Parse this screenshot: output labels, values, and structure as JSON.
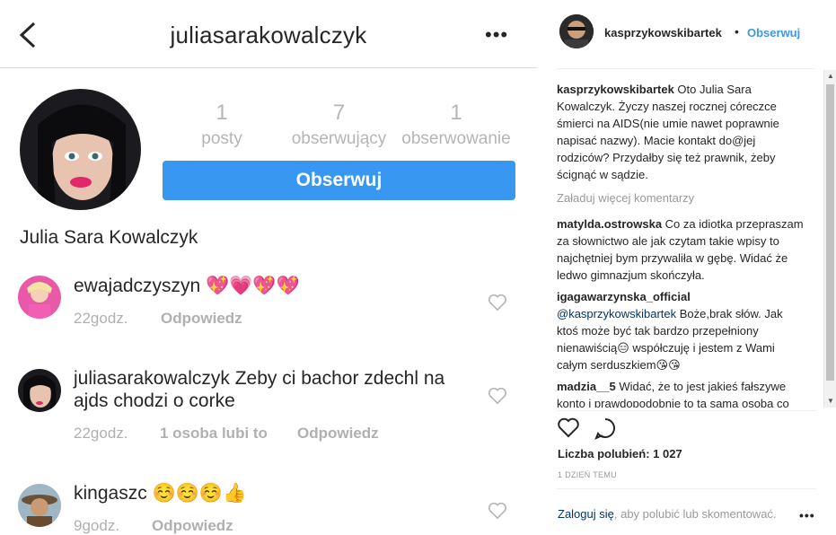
{
  "phone": {
    "header": {
      "username": "juliasarakowalczyk",
      "more_icon": "more-horizontal-icon",
      "back_icon": "chevron-left-icon"
    },
    "profile": {
      "stats": [
        {
          "value": "1",
          "label": "posty"
        },
        {
          "value": "7",
          "label": "obserwujący"
        },
        {
          "value": "1",
          "label": "obserwowanie"
        }
      ],
      "follow_label": "Obserwuj",
      "full_name": "Julia Sara Kowalczyk"
    },
    "comments": [
      {
        "text": "ewajadczyszyn 💖💗💖💖",
        "time": "22godz.",
        "likes": "",
        "reply": "Odpowiedz"
      },
      {
        "text": "juliasarakowalczyk Zeby ci bachor zdechl na ajds chodzi o corke",
        "time": "22godz.",
        "likes": "1 osoba lubi to",
        "reply": "Odpowiedz"
      },
      {
        "text": "kingaszc ☺️☺️☺️👍",
        "time": "9godz.",
        "likes": "",
        "reply": "Odpowiedz"
      }
    ]
  },
  "panel": {
    "username": "kasprzykowskibartek",
    "dot": "•",
    "follow_label": "Obserwuj",
    "caption": {
      "user": "kasprzykowskibartek",
      "text": "Oto Julia Sara Kowalczyk. Życzy naszej rocznej córeczce śmierci na AIDS(nie umie nawet poprawnie napisać nazwy). Macie kontakt do@jej rodziców? Przydałby się też prawnik, żeby ścignąć w sądzie."
    },
    "load_more": "Załaduj więcej komentarzy",
    "comments": [
      {
        "user": "matylda.ostrowska",
        "mention": "",
        "text": "Co za idiotka przepraszam za słownictwo ale jak czytam takie wpisy to najchętniej bym przywaliła w gębę. Widać że ledwo gimnazjum skończyła."
      },
      {
        "user": "igagawarzynska_official",
        "mention": "@kasprzykowskibartek",
        "text": "Boże,brak słów. Jak ktoś może być tak bardzo przepełniony nienawiścią😑 współczuję i jestem z Wami całym serduszkiem😘😘"
      },
      {
        "user": "madzia__5",
        "mention": "",
        "text": "Widać, że to jest jakieś fałszywe konto i prawdopodobnie to ta sama osoba co pisała na fb. Nie skomentuje jej"
      }
    ],
    "likes_text": "Liczba polubień: 1 027",
    "time_text": "1 DZIEŃ TEMU",
    "login_link": "Zaloguj się",
    "login_text": ", aby polubić lub skomentować.",
    "more_icon": "more-horizontal-icon"
  }
}
